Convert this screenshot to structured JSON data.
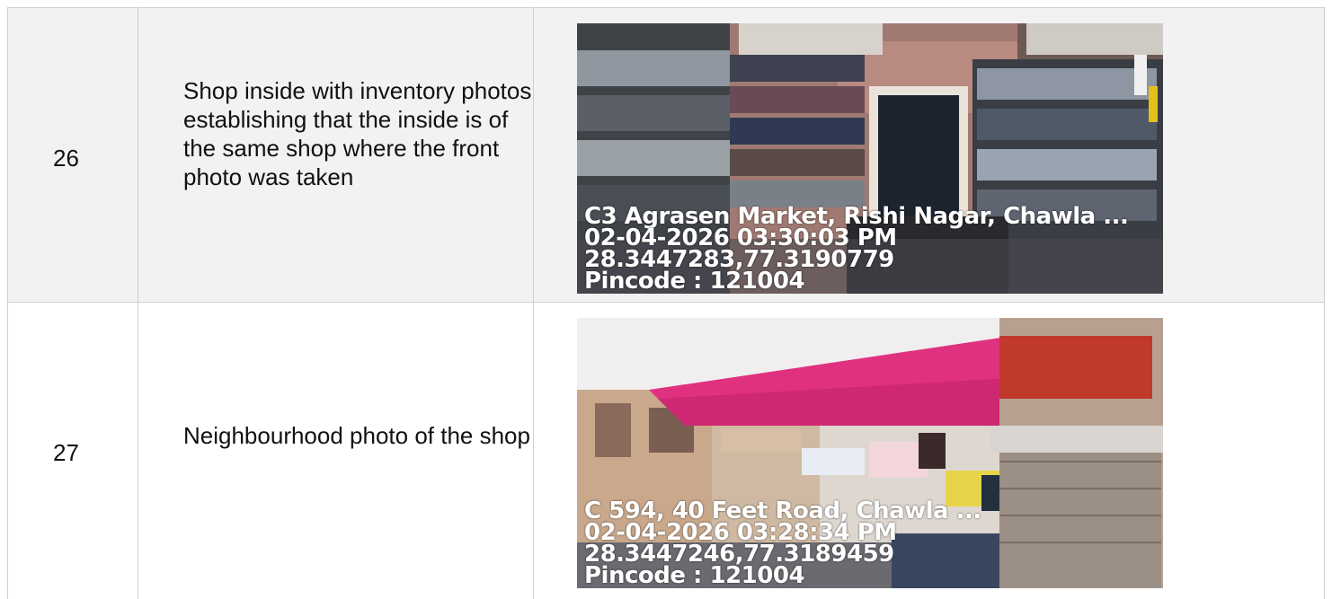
{
  "rows": [
    {
      "number": "26",
      "description": "Shop inside with inventory photos establishing that the inside is of the same shop where the front photo was taken",
      "photo": {
        "subject": "shop-interior-inventory-photo",
        "stamp_address": "C3 Agrasen Market, Rishi Nagar, Chawla ...",
        "stamp_datetime": "02-04-2026 03:30:03 PM",
        "stamp_coords": "28.3447283,77.3190779",
        "stamp_pincode": "Pincode : 121004"
      }
    },
    {
      "number": "27",
      "description": "Neighbourhood photo of the shop",
      "photo": {
        "subject": "neighbourhood-street-photo",
        "stamp_address": "C 594, 40 Feet Road, Chawla ...",
        "stamp_datetime": "02-04-2026 03:28:34 PM",
        "stamp_coords": "28.3447246,77.3189459",
        "stamp_pincode": "Pincode : 121004"
      }
    }
  ]
}
